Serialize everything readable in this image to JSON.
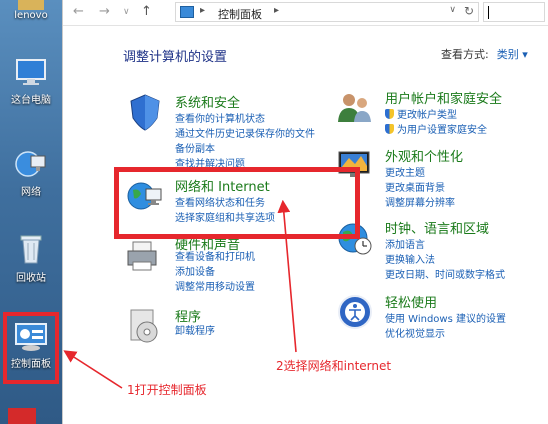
{
  "desktop": {
    "icons": [
      {
        "label": "lenovo"
      },
      {
        "label": "这台电脑"
      },
      {
        "label": "网络"
      },
      {
        "label": "回收站"
      },
      {
        "label": "控制面板"
      }
    ]
  },
  "address_bar": {
    "breadcrumb": "控制面板",
    "nav_back": "←",
    "nav_forward": "→",
    "nav_up": "↑",
    "dropdown": "∨",
    "refresh": "↻"
  },
  "page": {
    "title": "调整计算机的设置",
    "view_by_label": "查看方式:",
    "view_by_value": "类别 ▾"
  },
  "categories": [
    {
      "title": "系统和安全",
      "links": [
        "查看你的计算机状态",
        "通过文件历史记录保存你的文件",
        "备份副本",
        "查找并解决问题"
      ]
    },
    {
      "title": "网络和 Internet",
      "links": [
        "查看网络状态和任务",
        "选择家庭组和共享选项"
      ]
    },
    {
      "title": "硬件和声音",
      "links": [
        "查看设备和打印机",
        "添加设备",
        "调整常用移动设置"
      ]
    },
    {
      "title": "程序",
      "links": [
        "卸载程序"
      ]
    },
    {
      "title": "用户帐户和家庭安全",
      "links": [
        "更改帐户类型",
        "为用户设置家庭安全"
      ]
    },
    {
      "title": "外观和个性化",
      "links": [
        "更改主题",
        "更改桌面背景",
        "调整屏幕分辨率"
      ]
    },
    {
      "title": "时钟、语言和区域",
      "links": [
        "添加语言",
        "更换输入法",
        "更改日期、时间或数字格式"
      ]
    },
    {
      "title": "轻松使用",
      "links": [
        "使用 Windows 建议的设置",
        "优化视觉显示"
      ]
    }
  ],
  "annotations": {
    "step1": "1打开控制面板",
    "step2": "2选择网络和internet",
    "color": "#e6272d"
  }
}
